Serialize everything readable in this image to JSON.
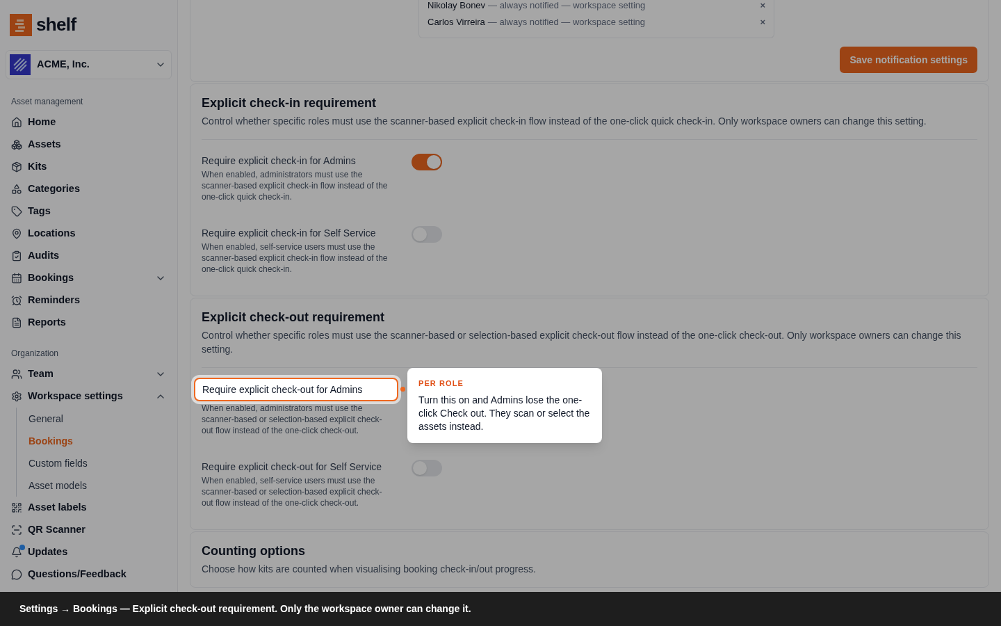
{
  "brand": "shelf",
  "workspace": "ACME, Inc.",
  "sidebar": [
    {
      "heading": "Asset management",
      "items": [
        {
          "label": "Home",
          "selected": false
        },
        {
          "label": "Assets",
          "selected": false
        },
        {
          "label": "Kits",
          "selected": false
        },
        {
          "label": "Categories",
          "selected": false
        },
        {
          "label": "Tags",
          "selected": false
        },
        {
          "label": "Locations",
          "selected": false
        },
        {
          "label": "Audits",
          "selected": false
        },
        {
          "label": "Bookings",
          "selected": false,
          "expanded": false
        },
        {
          "label": "Reminders",
          "selected": false
        },
        {
          "label": "Reports",
          "selected": false
        }
      ]
    },
    {
      "heading": "Organization",
      "items": [
        {
          "label": "Team",
          "selected": false,
          "expanded": false
        },
        {
          "label": "Workspace settings",
          "selected": false,
          "expanded": true,
          "children": [
            {
              "label": "General",
              "selected": false
            },
            {
              "label": "Bookings",
              "selected": true
            },
            {
              "label": "Custom fields",
              "selected": false
            },
            {
              "label": "Asset models",
              "selected": false
            }
          ]
        },
        {
          "label": "Asset labels",
          "selected": false
        },
        {
          "label": "QR Scanner",
          "selected": false
        },
        {
          "label": "Updates",
          "selected": false,
          "unread": true
        },
        {
          "label": "Questions/Feedback",
          "selected": false
        }
      ]
    }
  ],
  "recipients": [
    {
      "name": "Nikolay Bonev",
      "note": "— always notified — workspace setting",
      "remove": "×"
    },
    {
      "name": "Carlos Virreira",
      "note": "— always notified — workspace setting",
      "remove": "×"
    }
  ],
  "save_button": "Save notification settings",
  "sections": [
    {
      "title": "Explicit check-in requirement",
      "description": "Control whether specific roles must use the scanner-based explicit check-in flow instead of the one-click quick check-in. Only workspace owners can change this setting.",
      "settings": [
        {
          "label": "Require explicit check-in for Admins",
          "description": "When enabled, administrators must use the scanner-based explicit check-in flow instead of the one-click quick check-in.",
          "on": true,
          "spotlight": false
        },
        {
          "label": "Require explicit check-in for Self Service",
          "description": "When enabled, self-service users must use the scanner-based explicit check-in flow instead of the one-click quick check-in.",
          "on": false,
          "spotlight": false
        }
      ]
    },
    {
      "title": "Explicit check-out requirement",
      "description": "Control whether specific roles must use the scanner-based or selection-based explicit check-out flow instead of the one-click check-out. Only workspace owners can change this setting.",
      "settings": [
        {
          "label": "Require explicit check-out for Admins",
          "description": "When enabled, administrators must use the scanner-based or selection-based explicit check-out flow instead of the one-click check-out.",
          "spotlight": true
        },
        {
          "label": "Require explicit check-out for Self Service",
          "description": "When enabled, self-service users must use the scanner-based or selection-based explicit check-out flow instead of the one-click check-out.",
          "on": false,
          "spotlight": false
        }
      ]
    },
    {
      "title": "Counting options",
      "description": "Choose how kits are counted when visualising booking check-in/out progress."
    }
  ],
  "tooltip": {
    "eyebrow": "PER ROLE",
    "text": "Turn this on and Admins lose the one-click Check out. They scan or select the assets instead."
  },
  "caption": "Settings → Bookings — Explicit check-out requirement. Only the workspace owner can change it."
}
